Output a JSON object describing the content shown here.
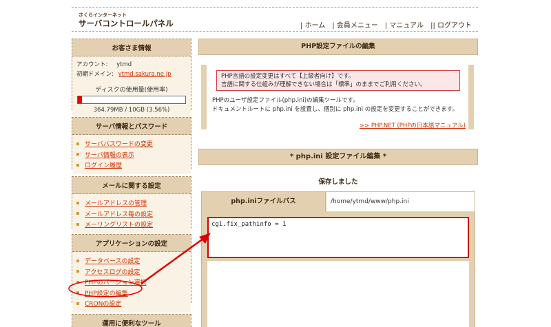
{
  "header": {
    "logo_small": "さくらインターネット",
    "logo_main": "サーバコントロールパネル",
    "nav": [
      "| ホーム",
      "| 会員メニュー",
      "| マニュアル",
      "|| ログアウト"
    ]
  },
  "sidebar": {
    "customer": {
      "title": "お客さま情報",
      "account_label": "アカウント:",
      "account_value": "ytmd",
      "domain_label": "初期ドメイン:",
      "domain_value": "ytmd.sakura.ne.jp",
      "disk_label": "ディスクの使用量(使用率)",
      "disk_usage": "364.79MB / 10GB (3.56%)",
      "disk_percent": 3.56
    },
    "server": {
      "title": "サーバ情報とパスワード",
      "items": [
        "サーバパスワードの変更",
        "サーバ情報の表示",
        "ログイン履歴"
      ]
    },
    "mail": {
      "title": "メールに関する設定",
      "items": [
        "メールアドレスの管理",
        "メールアドレス毎の設定",
        "メーリングリストの設定"
      ]
    },
    "app": {
      "title": "アプリケーションの設定",
      "items": [
        "データベースの設定",
        "アクセスログの設定",
        "PHPのバージョン選択",
        "PHP設定の編集",
        "CRONの設定"
      ]
    },
    "tools": {
      "title": "運用に便利なツール"
    }
  },
  "main": {
    "title": "PHP設定ファイルの編集",
    "warning_line1": "PHP言語の設定変更はすべて【上級者向け】です。",
    "warning_line2": "言語に関する仕組みが理解できない場合は「標準」のままでご利用ください。",
    "desc_line1": "PHPのユーザ設定ファイル(php.ini)の編集ツールです。",
    "desc_line2": "ドキュメントルートに php.ini を設置し、個別に php.ini の設定を変更することができます。",
    "doc_link": ">> PHP.NET (PHPの日本語マニュアル)",
    "subtitle": "* php.ini 設定ファイル編集 *",
    "saved_message": "保存しました",
    "path_label": "php.iniファイルパス",
    "path_value": "/home/ytmd/www/php.ini",
    "editor_content": "cgi.fix_pathinfo = 1"
  },
  "colors": {
    "accent_tan": "#e3d0b0",
    "link_red": "#cc3300",
    "annotation_red": "#e00000"
  }
}
